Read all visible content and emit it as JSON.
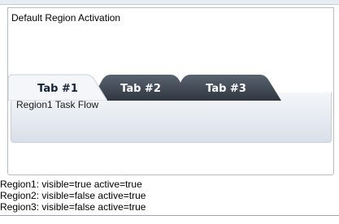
{
  "panel": {
    "title": "Default Region Activation"
  },
  "tabs": [
    {
      "label": "Tab #1",
      "selected": true
    },
    {
      "label": "Tab #2",
      "selected": false
    },
    {
      "label": "Tab #3",
      "selected": false
    }
  ],
  "content": {
    "text": "Region1 Task Flow"
  },
  "status": [
    "Region1: visible=true active=true",
    "Region2: visible=false active=true",
    "Region3: visible=false active=true"
  ],
  "colors": {
    "selected_tab": "#f4f6f9",
    "unselected_tab": "#3f4853",
    "content_gradient_bottom": "#d9e0e9"
  }
}
